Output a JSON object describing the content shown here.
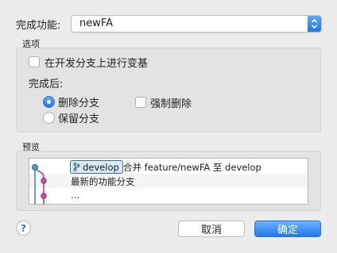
{
  "header": {
    "feature_label": "完成功能:",
    "feature_value": "newFA"
  },
  "options": {
    "title": "选项",
    "rebase_label": "在开发分支上进行变基",
    "rebase_checked": false,
    "after_label": "完成后:",
    "delete_label": "删除分支",
    "delete_selected": true,
    "keep_label": "保留分支",
    "keep_selected": false,
    "force_delete_label": "强制删除",
    "force_delete_checked": false
  },
  "preview": {
    "title": "预览",
    "rows": [
      {
        "tag": "develop",
        "text": "合并 feature/newFA 至 develop"
      },
      {
        "text": "最新的功能分支"
      },
      {
        "text": "..."
      }
    ],
    "colors": {
      "develop": "#3a8fb0",
      "feature": "#b0478f"
    }
  },
  "footer": {
    "help_label": "?",
    "cancel_label": "取消",
    "ok_label": "确定"
  }
}
